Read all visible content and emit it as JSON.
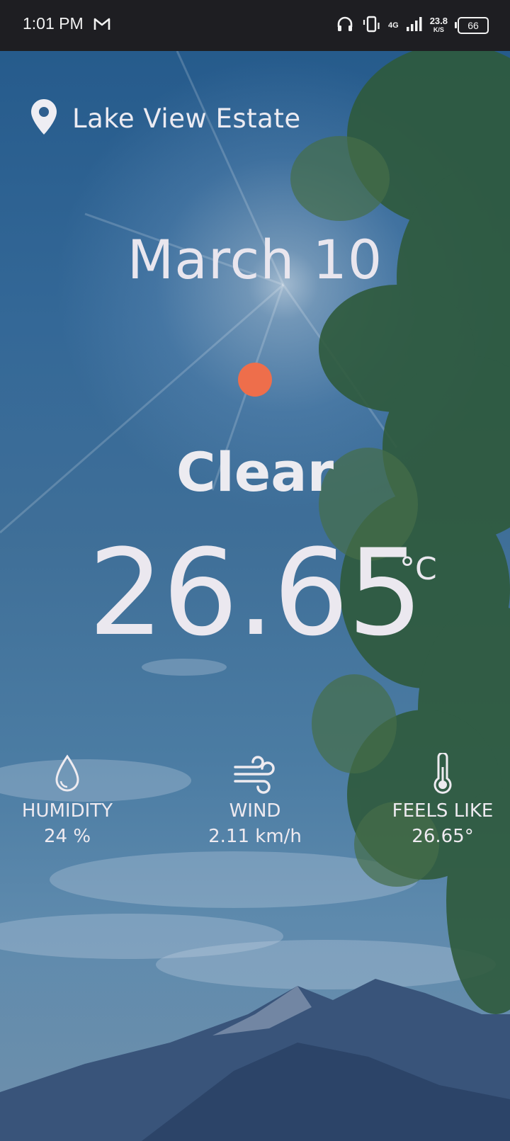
{
  "status_bar": {
    "time": "1:01 PM",
    "network_type": "4G",
    "network_speed": "23.8",
    "network_speed_unit": "K/S",
    "battery": "66"
  },
  "weather": {
    "location": "Lake View Estate",
    "date": "March 10",
    "condition": "Clear",
    "temperature": "26.65",
    "temperature_unit": "°C",
    "accent_color": "#ee6e4b"
  },
  "stats": [
    {
      "icon": "droplet-icon",
      "label": "HUMIDITY",
      "value": "24 %"
    },
    {
      "icon": "wind-icon",
      "label": "WIND",
      "value": "2.11 km/h"
    },
    {
      "icon": "thermometer-icon",
      "label": "FEELS LIKE",
      "value": "26.65°"
    }
  ]
}
